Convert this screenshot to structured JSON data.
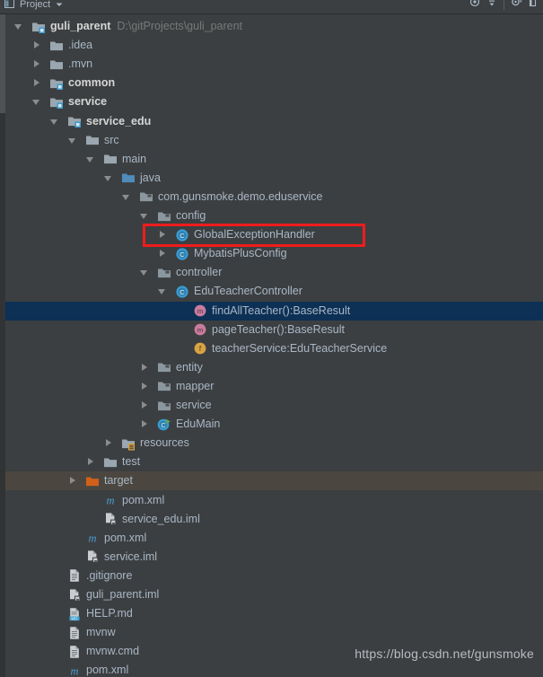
{
  "window": {
    "tool_title": "Project",
    "toolbar_icons": [
      "project-view-icon",
      "chevron-down-icon",
      "locate-icon",
      "collapse-all-icon",
      "settings-gear-icon",
      "hide-icon"
    ]
  },
  "colors": {
    "background": "#3c3f41",
    "text": "#a9b7c6",
    "selection": "#0d3055",
    "hover": "#4b4740",
    "annotation": "#ef1c1c",
    "folder": "#9aa7b0",
    "source_folder": "#4e96c8",
    "excluded_folder": "#d2601a",
    "class_icon": "#389fd6",
    "method_icon": "#c97b9e",
    "field_icon": "#d9a343",
    "maven_icon": "#4a9ed4",
    "path_text": "#787878"
  },
  "watermark": "https://blog.csdn.net/gunsmoke",
  "tree": {
    "rows": [
      {
        "label": "guli_parent",
        "path": "D:\\gitProjects\\guli_parent",
        "icon": "module-folder-icon",
        "twisty": "expanded",
        "indent": 0,
        "bold": true,
        "state": "normal"
      },
      {
        "label": ".idea",
        "path": "",
        "icon": "folder-icon",
        "twisty": "collapsed",
        "indent": 1,
        "bold": false,
        "state": "normal"
      },
      {
        "label": ".mvn",
        "path": "",
        "icon": "folder-icon",
        "twisty": "collapsed",
        "indent": 1,
        "bold": false,
        "state": "normal"
      },
      {
        "label": "common",
        "path": "",
        "icon": "module-folder-icon",
        "twisty": "collapsed",
        "indent": 1,
        "bold": true,
        "state": "normal"
      },
      {
        "label": "service",
        "path": "",
        "icon": "module-folder-icon",
        "twisty": "expanded",
        "indent": 1,
        "bold": true,
        "state": "normal"
      },
      {
        "label": "service_edu",
        "path": "",
        "icon": "module-folder-icon",
        "twisty": "expanded",
        "indent": 2,
        "bold": true,
        "state": "normal"
      },
      {
        "label": "src",
        "path": "",
        "icon": "folder-icon",
        "twisty": "expanded",
        "indent": 3,
        "bold": false,
        "state": "normal"
      },
      {
        "label": "main",
        "path": "",
        "icon": "folder-icon",
        "twisty": "expanded",
        "indent": 4,
        "bold": false,
        "state": "normal"
      },
      {
        "label": "java",
        "path": "",
        "icon": "source-folder-icon",
        "twisty": "expanded",
        "indent": 5,
        "bold": false,
        "state": "normal"
      },
      {
        "label": "com.gunsmoke.demo.eduservice",
        "path": "",
        "icon": "package-icon",
        "twisty": "expanded",
        "indent": 6,
        "bold": false,
        "state": "normal"
      },
      {
        "label": "config",
        "path": "",
        "icon": "package-icon",
        "twisty": "expanded",
        "indent": 7,
        "bold": false,
        "state": "normal"
      },
      {
        "label": "GlobalExceptionHandler",
        "path": "",
        "icon": "class-icon",
        "twisty": "collapsed",
        "indent": 8,
        "bold": false,
        "state": "annotated"
      },
      {
        "label": "MybatisPlusConfig",
        "path": "",
        "icon": "class-icon",
        "twisty": "collapsed",
        "indent": 8,
        "bold": false,
        "state": "normal"
      },
      {
        "label": "controller",
        "path": "",
        "icon": "package-icon",
        "twisty": "expanded",
        "indent": 7,
        "bold": false,
        "state": "normal"
      },
      {
        "label": "EduTeacherController",
        "path": "",
        "icon": "class-icon",
        "twisty": "expanded",
        "indent": 8,
        "bold": false,
        "state": "normal"
      },
      {
        "label": "findAllTeacher():BaseResult",
        "path": "",
        "icon": "method-icon",
        "twisty": "none",
        "indent": 9,
        "bold": false,
        "state": "selected"
      },
      {
        "label": "pageTeacher():BaseResult",
        "path": "",
        "icon": "method-icon",
        "twisty": "none",
        "indent": 9,
        "bold": false,
        "state": "normal"
      },
      {
        "label": "teacherService:EduTeacherService",
        "path": "",
        "icon": "field-icon",
        "twisty": "none",
        "indent": 9,
        "bold": false,
        "state": "normal"
      },
      {
        "label": "entity",
        "path": "",
        "icon": "package-icon",
        "twisty": "collapsed",
        "indent": 7,
        "bold": false,
        "state": "normal"
      },
      {
        "label": "mapper",
        "path": "",
        "icon": "package-icon",
        "twisty": "collapsed",
        "indent": 7,
        "bold": false,
        "state": "normal"
      },
      {
        "label": "service",
        "path": "",
        "icon": "package-icon",
        "twisty": "collapsed",
        "indent": 7,
        "bold": false,
        "state": "normal"
      },
      {
        "label": "EduMain",
        "path": "",
        "icon": "runnable-class-icon",
        "twisty": "collapsed",
        "indent": 7,
        "bold": false,
        "state": "normal"
      },
      {
        "label": "resources",
        "path": "",
        "icon": "resources-folder-icon",
        "twisty": "collapsed",
        "indent": 5,
        "bold": false,
        "state": "normal"
      },
      {
        "label": "test",
        "path": "",
        "icon": "folder-icon",
        "twisty": "collapsed",
        "indent": 4,
        "bold": false,
        "state": "normal"
      },
      {
        "label": "target",
        "path": "",
        "icon": "excluded-folder-icon",
        "twisty": "collapsed",
        "indent": 3,
        "bold": false,
        "state": "hovered"
      },
      {
        "label": "pom.xml",
        "path": "",
        "icon": "maven-file-icon",
        "twisty": "none",
        "indent": 4,
        "bold": false,
        "state": "normal"
      },
      {
        "label": "service_edu.iml",
        "path": "",
        "icon": "iml-file-icon",
        "twisty": "none",
        "indent": 4,
        "bold": false,
        "state": "normal"
      },
      {
        "label": "pom.xml",
        "path": "",
        "icon": "maven-file-icon",
        "twisty": "none",
        "indent": 3,
        "bold": false,
        "state": "normal"
      },
      {
        "label": "service.iml",
        "path": "",
        "icon": "iml-file-icon",
        "twisty": "none",
        "indent": 3,
        "bold": false,
        "state": "normal"
      },
      {
        "label": ".gitignore",
        "path": "",
        "icon": "text-file-icon",
        "twisty": "none",
        "indent": 2,
        "bold": false,
        "state": "normal"
      },
      {
        "label": "guli_parent.iml",
        "path": "",
        "icon": "iml-file-icon",
        "twisty": "none",
        "indent": 2,
        "bold": false,
        "state": "normal"
      },
      {
        "label": "HELP.md",
        "path": "",
        "icon": "markdown-file-icon",
        "twisty": "none",
        "indent": 2,
        "bold": false,
        "state": "normal"
      },
      {
        "label": "mvnw",
        "path": "",
        "icon": "text-file-icon",
        "twisty": "none",
        "indent": 2,
        "bold": false,
        "state": "normal"
      },
      {
        "label": "mvnw.cmd",
        "path": "",
        "icon": "text-file-icon",
        "twisty": "none",
        "indent": 2,
        "bold": false,
        "state": "normal"
      },
      {
        "label": "pom.xml",
        "path": "",
        "icon": "maven-file-icon",
        "twisty": "none",
        "indent": 2,
        "bold": false,
        "state": "normal"
      }
    ]
  }
}
